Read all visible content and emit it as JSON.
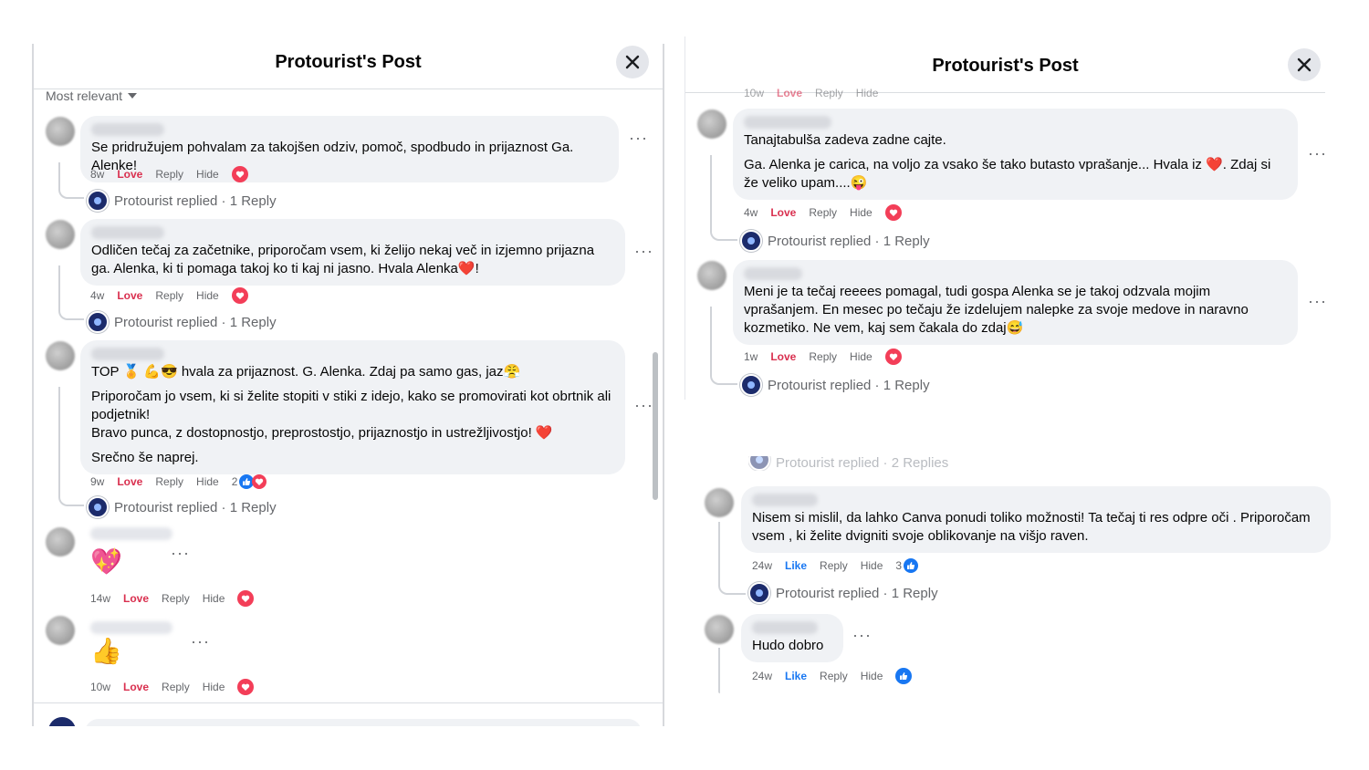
{
  "left": {
    "title": "Protourist's Post",
    "sort_label": "Most relevant",
    "comments": [
      {
        "text": "Se pridružujem pohvalam za takojšen odziv, pomoč, spodbudo in prijaznost Ga. Alenke!",
        "time": "8w",
        "love": "Love",
        "reply": "Reply",
        "hide": "Hide",
        "replied": "Protourist replied · 1 Reply"
      },
      {
        "text": "Odličen tečaj za začetnike, priporočam vsem, ki želijo nekaj več in izjemno prijazna ga. Alenka, ki ti pomaga takoj ko ti kaj ni jasno. Hvala Alenka❤️!",
        "time": "4w",
        "love": "Love",
        "reply": "Reply",
        "hide": "Hide",
        "replied": "Protourist replied · 1 Reply"
      },
      {
        "line1": "TOP 🏅 💪😎 hvala za prijaznost. G. Alenka. Zdaj pa samo gas, jaz😤",
        "line2": "Priporočam jo vsem, ki si želite stopiti v stiki z idejo, kako se promovirati kot obrtnik ali podjetnik!",
        "line3": "Bravo punca, z dostopnostjo, preprostostjo, prijaznostjo in ustrežljivostjo! ❤️",
        "line4": "Srečno še naprej.",
        "time": "9w",
        "love": "Love",
        "reply": "Reply",
        "hide": "Hide",
        "reaction_count": "2",
        "replied": "Protourist replied · 1 Reply"
      },
      {
        "emoji": "💖",
        "time": "14w",
        "love": "Love",
        "reply": "Reply",
        "hide": "Hide"
      },
      {
        "emoji": "👍",
        "time": "10w",
        "love": "Love",
        "reply": "Reply",
        "hide": "Hide"
      }
    ]
  },
  "right": {
    "title": "Protourist's Post",
    "top_partial": {
      "time": "10w",
      "love": "Love",
      "reply": "Reply",
      "hide": "Hide"
    },
    "comments": [
      {
        "line1": "Tanajtabulša zadeva zadne cajte.",
        "line2": "Ga. Alenka je carica, na voljo za vsako še tako butasto vprašanje... Hvala iz ❤️. Zdaj si že veliko upam....😜",
        "time": "4w",
        "love": "Love",
        "reply": "Reply",
        "hide": "Hide",
        "replied": "Protourist replied · 1 Reply"
      },
      {
        "text": "Meni je ta tečaj reeees pomagal, tudi gospa Alenka se je takoj odzvala mojim vprašanjem. En mesec po tečaju že izdelujem nalepke za svoje medove in naravno kozmetiko. Ne vem, kaj sem čakala do zdaj😅",
        "time": "1w",
        "love": "Love",
        "reply": "Reply",
        "hide": "Hide",
        "replied": "Protourist replied · 1 Reply"
      }
    ]
  },
  "right2": {
    "partial_replied": "Protourist replied · 2 Replies",
    "comments": [
      {
        "text": "Nisem si mislil, da lahko Canva ponudi toliko možnosti! Ta tečaj ti res odpre oči . Priporočam vsem , ki želite dvigniti svoje oblikovanje na višjo raven.",
        "time": "24w",
        "like": "Like",
        "reply": "Reply",
        "hide": "Hide",
        "reaction_count": "3",
        "replied": "Protourist replied · 1 Reply"
      },
      {
        "text": "Hudo dobro",
        "time": "24w",
        "like": "Like",
        "reply": "Reply",
        "hide": "Hide"
      }
    ]
  },
  "colors": {
    "love": "#d9304f",
    "like": "#1877f2",
    "bubble": "#f0f2f5"
  },
  "more_label": "···"
}
